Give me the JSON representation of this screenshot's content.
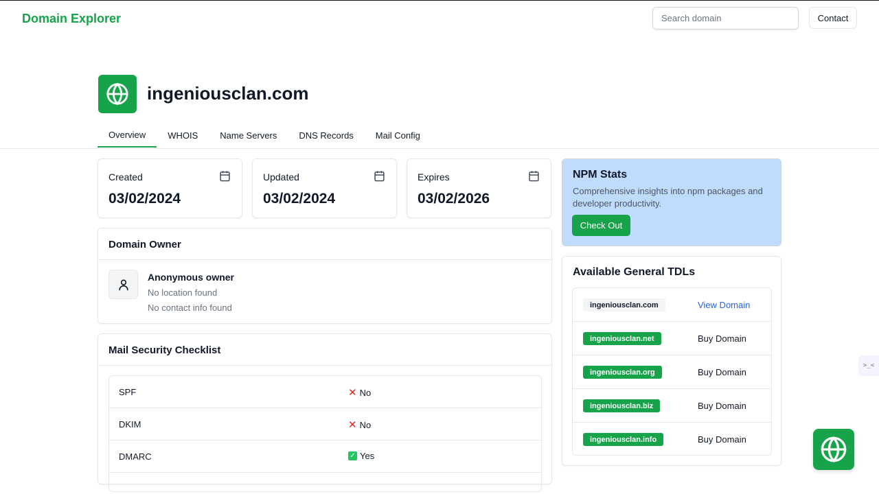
{
  "header": {
    "brand": "Domain Explorer",
    "search_placeholder": "Search domain",
    "contact_label": "Contact"
  },
  "domain": {
    "name": "ingeniousclan.com"
  },
  "tabs": [
    {
      "label": "Overview",
      "active": true
    },
    {
      "label": "WHOIS"
    },
    {
      "label": "Name Servers"
    },
    {
      "label": "DNS Records"
    },
    {
      "label": "Mail Config"
    }
  ],
  "dates": [
    {
      "label": "Created",
      "value": "03/02/2024"
    },
    {
      "label": "Updated",
      "value": "03/02/2024"
    },
    {
      "label": "Expires",
      "value": "03/02/2026"
    }
  ],
  "owner": {
    "title": "Domain Owner",
    "name": "Anonymous owner",
    "location": "No location found",
    "contact": "No contact info found"
  },
  "mail_security": {
    "title": "Mail Security Checklist",
    "rows": [
      {
        "key": "SPF",
        "value": "No",
        "status": "fail"
      },
      {
        "key": "DKIM",
        "value": "No",
        "status": "fail"
      },
      {
        "key": "DMARC",
        "value": "Yes",
        "status": "pass"
      }
    ]
  },
  "promo": {
    "title": "NPM Stats",
    "description": "Comprehensive insights into npm packages and developer productivity.",
    "button_label": "Check Out"
  },
  "tlds": {
    "title": "Available General TDLs",
    "items": [
      {
        "domain": "ingeniousclan.com",
        "action": "View Domain",
        "available": false
      },
      {
        "domain": "ingeniousclan.net",
        "action": "Buy Domain",
        "available": true
      },
      {
        "domain": "ingeniousclan.org",
        "action": "Buy Domain",
        "available": true
      },
      {
        "domain": "ingeniousclan.biz",
        "action": "Buy Domain",
        "available": true
      },
      {
        "domain": "ingeniousclan.info",
        "action": "Buy Domain",
        "available": true
      }
    ]
  },
  "side_widget": {
    "label": ">_<"
  },
  "colors": {
    "brand_green": "#16a34a",
    "promo_blue": "#bfdbfe",
    "link_blue": "#2563eb",
    "fail_red": "#dc2626"
  }
}
